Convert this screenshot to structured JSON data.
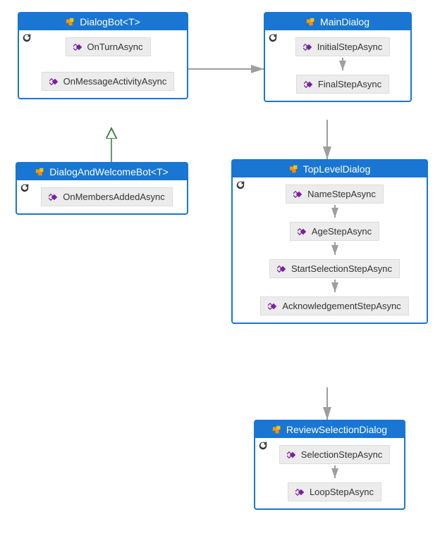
{
  "boxes": {
    "dialogBot": {
      "title": "DialogBot<T>",
      "members": [
        "OnTurnAsync",
        "OnMessageActivityAsync"
      ]
    },
    "dialogAndWelcomeBot": {
      "title": "DialogAndWelcomeBot<T>",
      "members": [
        "OnMembersAddedAsync"
      ]
    },
    "mainDialog": {
      "title": "MainDialog",
      "members": [
        "InitialStepAsync",
        "FinalStepAsync"
      ]
    },
    "topLevelDialog": {
      "title": "TopLevelDialog",
      "members": [
        "NameStepAsync",
        "AgeStepAsync",
        "StartSelectionStepAsync",
        "AcknowledgementStepAsync"
      ]
    },
    "reviewSelectionDialog": {
      "title": "ReviewSelectionDialog",
      "members": [
        "SelectionStepAsync",
        "LoopStepAsync"
      ]
    }
  }
}
